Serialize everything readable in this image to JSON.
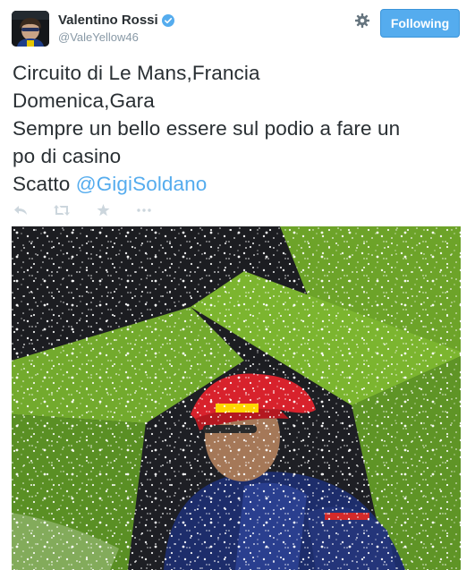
{
  "user": {
    "name": "Valentino Rossi",
    "handle": "@ValeYellow46"
  },
  "follow_button": {
    "label": "Following"
  },
  "tweet": {
    "line1": "Circuito di Le Mans,Francia",
    "line2": "Domenica,Gara",
    "line3": "Sempre un bello essere sul podio a fare un",
    "line4": "po di casino",
    "line5_prefix": "Scatto ",
    "mention": "@GigiSoldano"
  },
  "icons": {
    "verified": "verified-badge-icon",
    "settings": "gear-icon",
    "reply": "reply-icon",
    "retweet": "retweet-icon",
    "favorite": "star-icon",
    "more": "more-icon"
  },
  "colors": {
    "accent": "#55acee",
    "text": "#292f33",
    "muted": "#8899a6",
    "action_icons": "#ccd6dd"
  }
}
